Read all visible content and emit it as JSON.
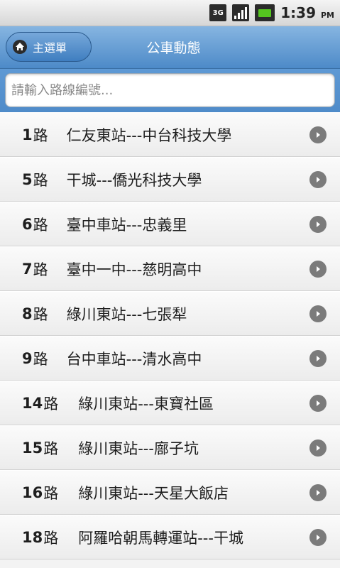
{
  "status_bar": {
    "network": "3G",
    "time": "1:39",
    "ampm": "PM"
  },
  "header": {
    "home_label": "主選單",
    "title": "公車動態"
  },
  "search": {
    "placeholder": "請輸入路線編號..."
  },
  "colors": {
    "header": "#5b95d0",
    "list_bg": "#f3f3f3",
    "chevron": "#7b7b7b"
  },
  "routes": [
    {
      "number": "1",
      "suffix": "路",
      "name": "仁友東站---中台科技大學"
    },
    {
      "number": "5",
      "suffix": "路",
      "name": "干城---僑光科技大學"
    },
    {
      "number": "6",
      "suffix": "路",
      "name": "臺中車站---忠義里"
    },
    {
      "number": "7",
      "suffix": "路",
      "name": "臺中一中---慈明高中"
    },
    {
      "number": "8",
      "suffix": "路",
      "name": "綠川東站---七張犁"
    },
    {
      "number": "9",
      "suffix": "路",
      "name": "台中車站---清水高中"
    },
    {
      "number": "14",
      "suffix": "路",
      "name": "綠川東站---東寶社區"
    },
    {
      "number": "15",
      "suffix": "路",
      "name": "綠川東站---廍子坑"
    },
    {
      "number": "16",
      "suffix": "路",
      "name": "綠川東站---天星大飯店"
    },
    {
      "number": "18",
      "suffix": "路",
      "name": "阿羅哈朝馬轉運站---干城"
    }
  ]
}
